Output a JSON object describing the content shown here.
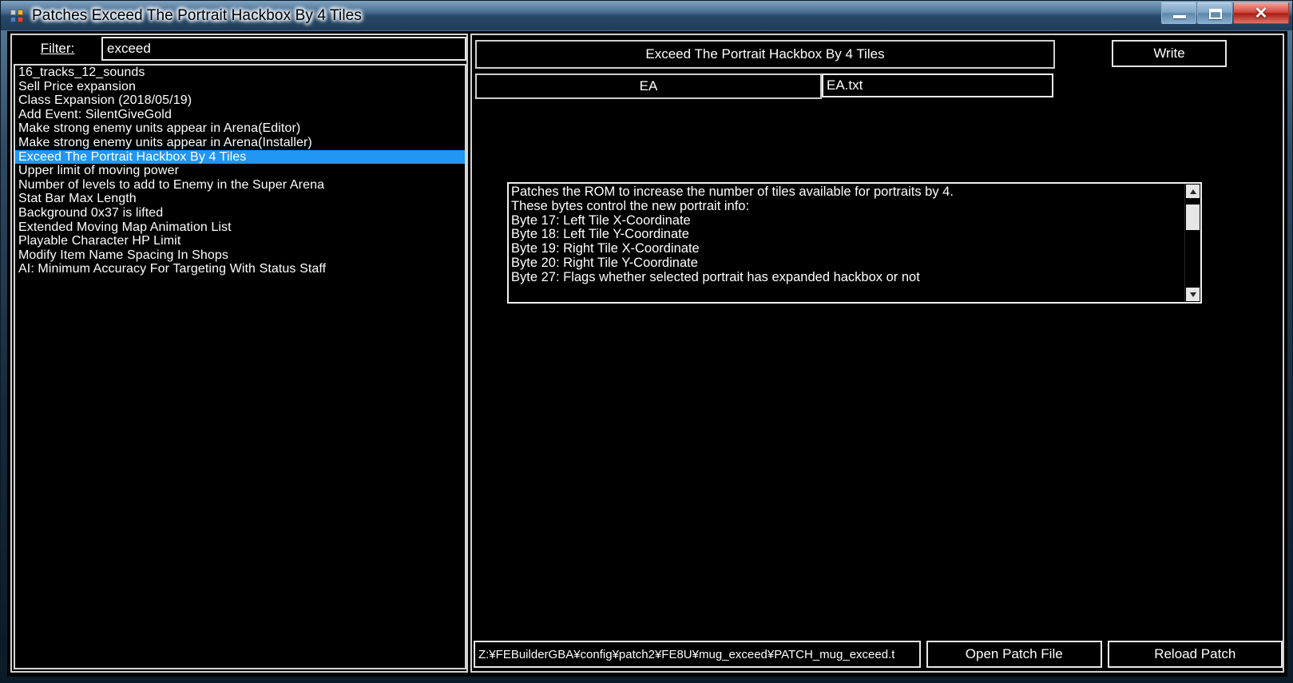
{
  "window": {
    "title": "Patches Exceed The Portrait Hackbox By 4 Tiles",
    "icon": "app-icon",
    "minimize_label": "–",
    "maximize_label": "□",
    "close_label": "✕"
  },
  "filter": {
    "label": "Filter:",
    "value": "exceed",
    "placeholder": ""
  },
  "patch_list": {
    "items": [
      {
        "label": "16_tracks_12_sounds",
        "selected": false
      },
      {
        "label": "Sell Price expansion",
        "selected": false
      },
      {
        "label": "Class Expansion (2018/05/19)",
        "selected": false
      },
      {
        "label": "Add Event: SilentGiveGold",
        "selected": false
      },
      {
        "label": "Make strong enemy units appear in Arena(Editor)",
        "selected": false
      },
      {
        "label": "Make strong enemy units appear in Arena(Installer)",
        "selected": false
      },
      {
        "label": "Exceed The Portrait Hackbox By 4 Tiles",
        "selected": true
      },
      {
        "label": "Upper limit of moving power",
        "selected": false
      },
      {
        "label": "Number of levels to add to Enemy in the Super Arena",
        "selected": false
      },
      {
        "label": "Stat Bar Max Length",
        "selected": false
      },
      {
        "label": "Background 0x37 is lifted",
        "selected": false
      },
      {
        "label": "Extended Moving Map Animation List",
        "selected": false
      },
      {
        "label": "Playable Character HP Limit",
        "selected": false
      },
      {
        "label": "Modify Item Name Spacing In Shops",
        "selected": false
      },
      {
        "label": "AI: Minimum Accuracy For Targeting With Status Staff",
        "selected": false
      }
    ]
  },
  "detail": {
    "patch_title": "Exceed The Portrait Hackbox By 4 Tiles",
    "write_button": "Write",
    "patch_type": "EA",
    "patch_file": "EA.txt",
    "description": "Patches the ROM to increase the number of tiles available for portraits by 4.\nThese bytes control the new portrait info:\nByte 17: Left Tile X-Coordinate\nByte 18: Left Tile Y-Coordinate\nByte 19: Right Tile X-Coordinate\nByte 20: Right Tile Y-Coordinate\nByte 27: Flags whether selected portrait has expanded hackbox or not",
    "scroll_up": "▲",
    "scroll_down": "▼"
  },
  "bottom": {
    "path": "Z:¥FEBuilderGBA¥config¥patch2¥FE8U¥mug_exceed¥PATCH_mug_exceed.t",
    "open_patch_file": "Open Patch File",
    "reload_patch": "Reload Patch"
  },
  "colors": {
    "selection": "#2196f3",
    "background": "#000000",
    "border": "#d2d2d2",
    "text": "#ffffff"
  }
}
